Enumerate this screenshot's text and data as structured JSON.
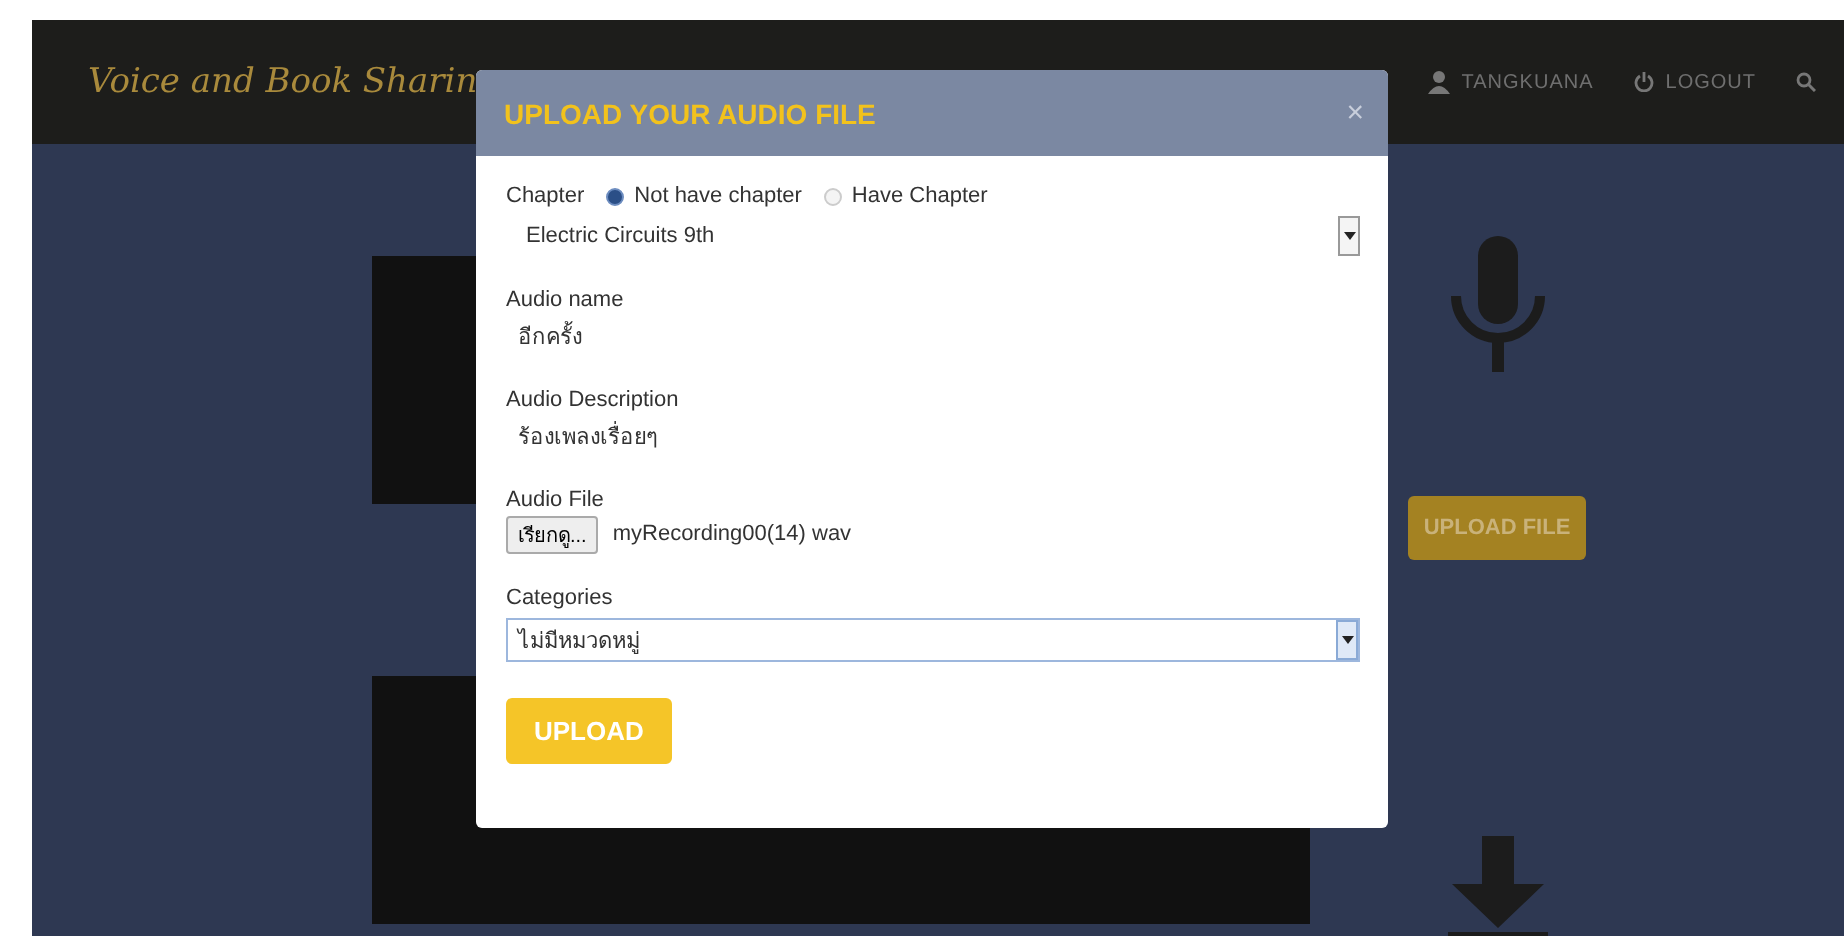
{
  "header": {
    "site_title": "Voice and Book Sharin",
    "user": "TANGKUANA",
    "logout": "LOGOUT"
  },
  "page": {
    "upload_file_button": "UPLOAD FILE"
  },
  "modal": {
    "title": "UPLOAD YOUR AUDIO FILE",
    "close": "×",
    "chapter": {
      "label": "Chapter",
      "options": [
        {
          "label": "Not have chapter",
          "selected": true
        },
        {
          "label": "Have Chapter",
          "selected": false
        }
      ],
      "book": "Electric Circuits 9th"
    },
    "audio_name": {
      "label": "Audio name",
      "value": "อีกครั้ง"
    },
    "audio_description": {
      "label": "Audio Description",
      "value": "ร้องเพลงเรื่อยๆ"
    },
    "audio_file": {
      "label": "Audio File",
      "browse": "เรียกดู...",
      "file_name": "myRecording00(14) wav"
    },
    "categories": {
      "label": "Categories",
      "value": "ไม่มีหมวดหมู่"
    },
    "submit": "UPLOAD"
  }
}
